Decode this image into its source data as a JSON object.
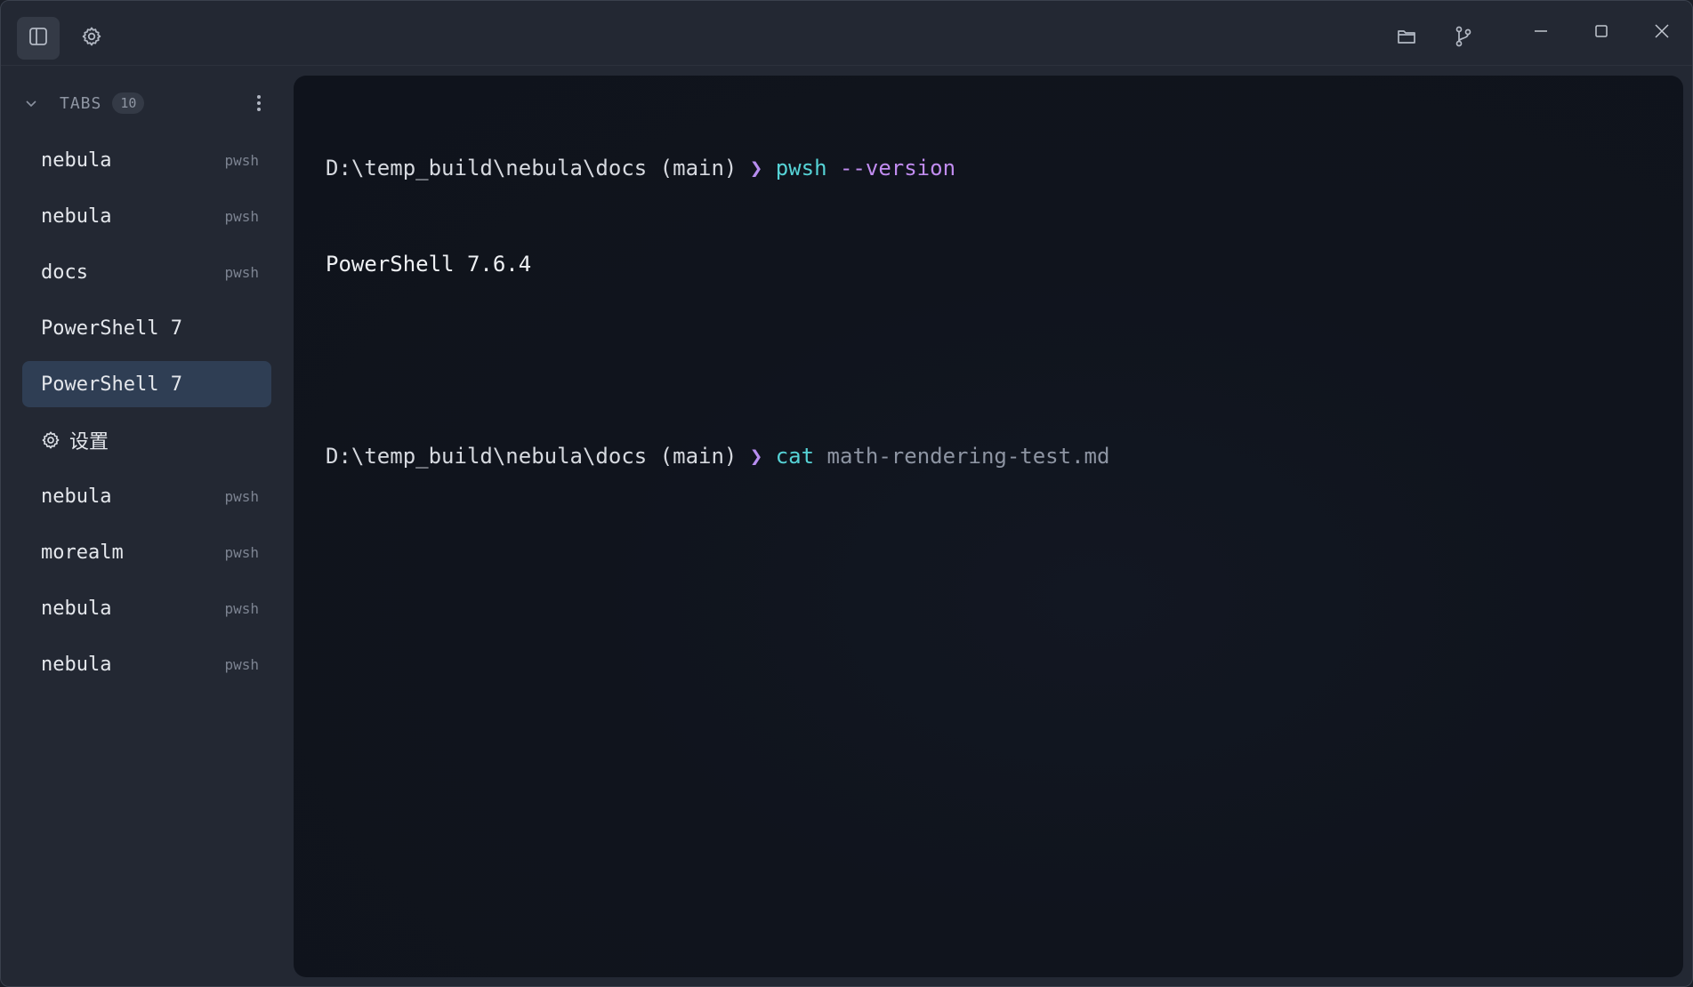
{
  "titlebar": {
    "icons": [
      "sidebar-toggle-icon",
      "gear-icon",
      "folder-icon",
      "git-branch-icon",
      "minimize-icon",
      "maximize-icon",
      "close-icon"
    ]
  },
  "sidebar": {
    "header": {
      "title": "TABS",
      "count": "10"
    },
    "tabs": [
      {
        "label": "nebula",
        "shell": "pwsh",
        "active": false
      },
      {
        "label": "nebula",
        "shell": "pwsh",
        "active": false
      },
      {
        "label": "docs",
        "shell": "pwsh",
        "active": false
      },
      {
        "label": "PowerShell 7",
        "shell": "",
        "active": false
      },
      {
        "label": "PowerShell 7",
        "shell": "",
        "active": true
      },
      {
        "label": "设置",
        "shell": "",
        "active": false,
        "icon": "gear-icon"
      },
      {
        "label": "nebula",
        "shell": "pwsh",
        "active": false
      },
      {
        "label": "morealm",
        "shell": "pwsh",
        "active": false
      },
      {
        "label": "nebula",
        "shell": "pwsh",
        "active": false
      },
      {
        "label": "nebula",
        "shell": "pwsh",
        "active": false
      }
    ]
  },
  "terminal": {
    "line1": {
      "path": "D:\\temp_build\\nebula\\docs (main)",
      "arrow": "❯",
      "command": "pwsh",
      "args": "--version"
    },
    "output1": "PowerShell 7.6.4",
    "line2": {
      "path": "D:\\temp_build\\nebula\\docs (main)",
      "arrow": "❯",
      "command": "cat",
      "args": "math-rendering-test.md"
    }
  },
  "colors": {
    "background": "#232833",
    "terminal_bg": "#10141d",
    "active_tab": "#2f3e54",
    "command": "#56d3d6",
    "prompt_arrow": "#b78df0",
    "flag": "#c18cf0"
  }
}
